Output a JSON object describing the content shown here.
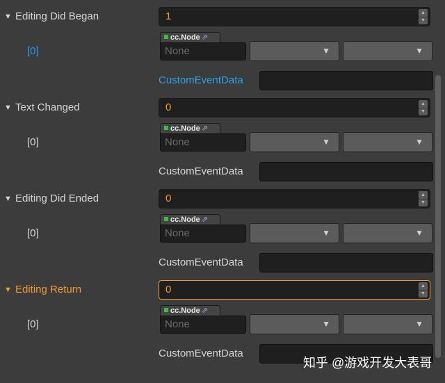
{
  "cc_node_label": "cc.Node",
  "node_placeholder": "None",
  "sections": [
    {
      "label": "Editing Did Began",
      "value": "1",
      "index_label": "[0]",
      "data_label": "CustomEventData"
    },
    {
      "label": "Text Changed",
      "value": "0",
      "index_label": "[0]",
      "data_label": "CustomEventData"
    },
    {
      "label": "Editing Did Ended",
      "value": "0",
      "index_label": "[0]",
      "data_label": "CustomEventData"
    },
    {
      "label": "Editing Return",
      "value": "0",
      "index_label": "[0]",
      "data_label": "CustomEventData"
    }
  ],
  "watermark": "知乎 @游戏开发大表哥",
  "colors": {
    "background": "#3c3c3c",
    "accent_orange": "#f39a2b",
    "link_blue": "#2aa0e6",
    "field_bg": "#1f1f1f"
  },
  "icons": {
    "collapse_arrow": "triangle-down",
    "dropdown_caret": "triangle-down",
    "spinner": "up-down-arrows",
    "external_link": "external-link-icon"
  }
}
